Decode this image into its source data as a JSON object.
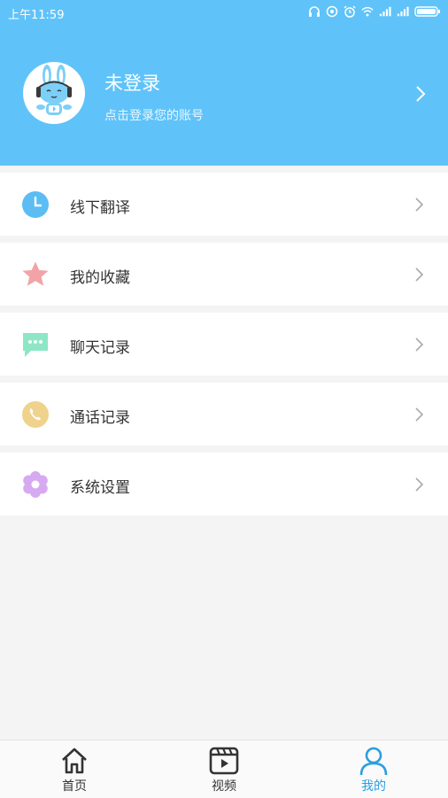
{
  "status_bar": {
    "time": "上午11:59"
  },
  "profile": {
    "name": "未登录",
    "subtitle": "点击登录您的账号"
  },
  "menu": [
    {
      "label": "线下翻译",
      "icon": "clock-icon",
      "color": "#5bbdf3"
    },
    {
      "label": "我的收藏",
      "icon": "star-icon",
      "color": "#f2a3a6"
    },
    {
      "label": "聊天记录",
      "icon": "chat-bubble-icon",
      "color": "#8de6c5"
    },
    {
      "label": "通话记录",
      "icon": "phone-icon",
      "color": "#efd28b"
    },
    {
      "label": "系统设置",
      "icon": "flower-gear-icon",
      "color": "#d6aaf0"
    }
  ],
  "tabs": [
    {
      "label": "首页",
      "icon": "home-icon",
      "active": false
    },
    {
      "label": "视频",
      "icon": "video-icon",
      "active": false
    },
    {
      "label": "我的",
      "icon": "user-icon",
      "active": true
    }
  ],
  "colors": {
    "header_bg": "#5fc3fa",
    "page_bg": "#f4f4f4",
    "tab_active": "#2a9ee0"
  }
}
